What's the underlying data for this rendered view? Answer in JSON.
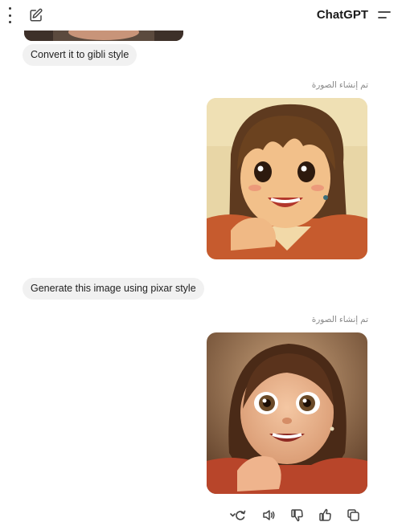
{
  "header": {
    "title": "ChatGPT",
    "icons": [
      "more-vertical-icon",
      "edit-icon",
      "sidebar-toggle-icon"
    ]
  },
  "messages": [
    {
      "role": "user",
      "text": "Convert it to gibli style"
    },
    {
      "role": "assistant",
      "status": "تم إنشاء الصورة",
      "image": "ghibli-style-girl"
    },
    {
      "role": "user",
      "text": "Generate this image using pixar style"
    },
    {
      "role": "assistant",
      "status": "تم إنشاء الصورة",
      "image": "pixar-style-girl"
    }
  ],
  "actions": [
    "regenerate-icon",
    "read-aloud-icon",
    "thumbs-down-icon",
    "thumbs-up-icon",
    "copy-icon"
  ],
  "colors": {
    "bubble_bg": "#f1f1f1",
    "status_text": "#8a8a8a",
    "icon": "#444444"
  }
}
